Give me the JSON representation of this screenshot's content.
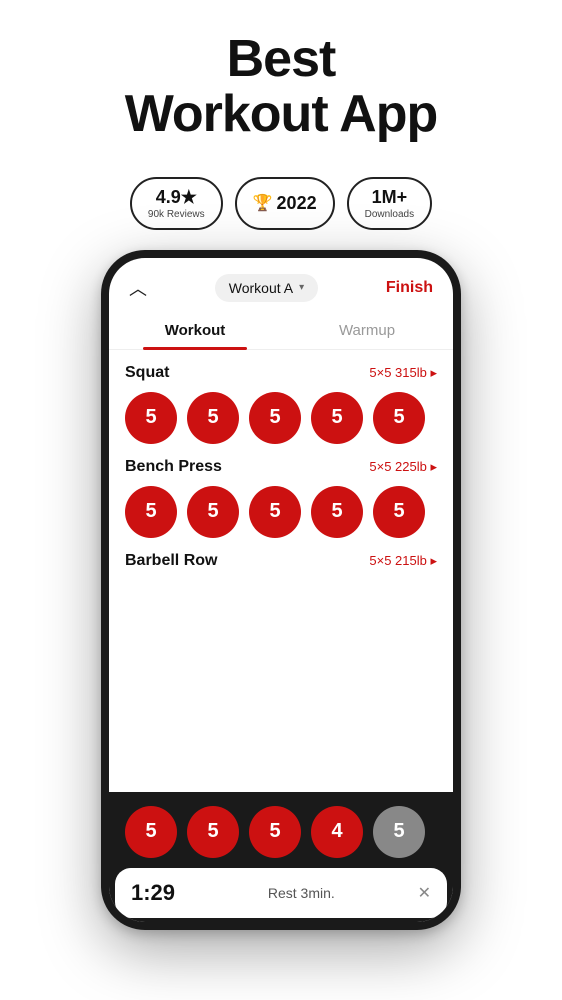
{
  "header": {
    "title_line1": "Best",
    "title_line2": "Workout App"
  },
  "badges": [
    {
      "id": "rating",
      "main": "4.9★",
      "sub": "90k Reviews",
      "icon": ""
    },
    {
      "id": "award",
      "main": "2022",
      "sub": "",
      "icon": "🏆"
    },
    {
      "id": "downloads",
      "main": "1M+",
      "sub": "Downloads",
      "icon": ""
    }
  ],
  "app": {
    "topbar": {
      "selector_label": "Workout A",
      "finish_label": "Finish"
    },
    "tabs": [
      {
        "id": "workout",
        "label": "Workout",
        "active": true
      },
      {
        "id": "warmup",
        "label": "Warmup",
        "active": false
      }
    ],
    "exercises": [
      {
        "id": "squat",
        "name": "Squat",
        "detail": "5×5 315lb ▸",
        "sets": [
          5,
          5,
          5,
          5,
          5
        ],
        "gray_last": false
      },
      {
        "id": "bench-press",
        "name": "Bench Press",
        "detail": "5×5 225lb ▸",
        "sets": [
          5,
          5,
          5,
          5,
          5
        ],
        "gray_last": false
      },
      {
        "id": "barbell-row",
        "name": "Barbell Row",
        "detail": "5×5 215lb ▸",
        "sets": [
          5,
          5,
          5,
          4,
          5
        ],
        "gray_last": true
      }
    ],
    "bottom_bar": {
      "rest_time": "1:29",
      "rest_label": "Rest 3min."
    }
  }
}
